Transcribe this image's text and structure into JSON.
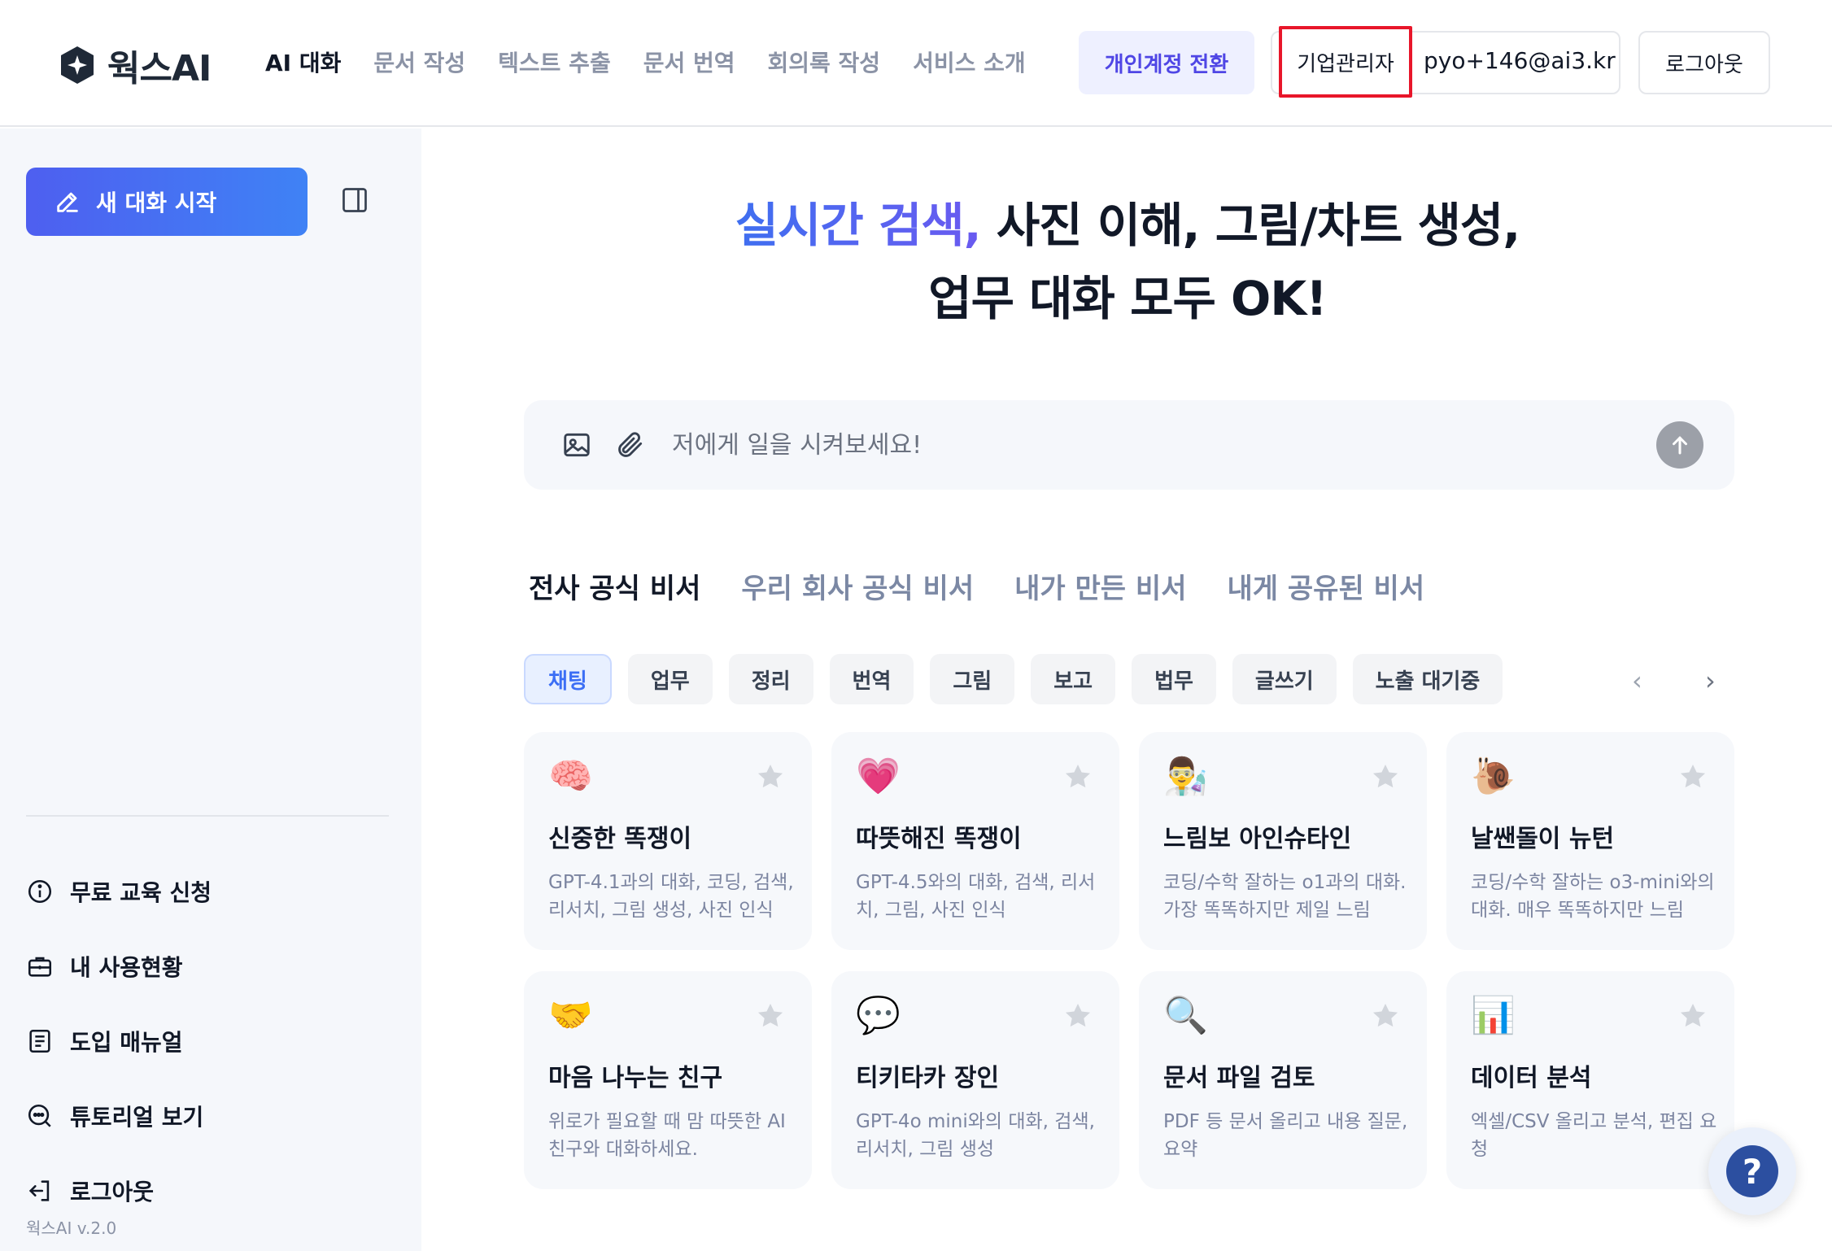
{
  "header": {
    "logo_text": "웍스AI",
    "nav": [
      "AI 대화",
      "문서 작성",
      "텍스트 추출",
      "문서 번역",
      "회의록 작성",
      "서비스 소개"
    ],
    "switch_label": "개인계정 전환",
    "admin_label": "기업관리자",
    "email": "pyo+146@ai3.kr",
    "logout_label": "로그아웃"
  },
  "sidebar": {
    "new_chat_label": "새 대화 시작",
    "menu": [
      {
        "label": "무료 교육 신청",
        "icon": "info-icon"
      },
      {
        "label": "내 사용현황",
        "icon": "briefcase-icon"
      },
      {
        "label": "도입 매뉴얼",
        "icon": "document-icon"
      },
      {
        "label": "튜토리얼 보기",
        "icon": "chat-search-icon"
      },
      {
        "label": "로그아웃",
        "icon": "logout-icon"
      }
    ],
    "version": "웍스AI v.2.0"
  },
  "hero": {
    "accent": "실시간 검색,",
    "line1_rest": " 사진 이해, 그림/차트 생성,",
    "line2": "업무 대화 모두 OK!"
  },
  "prompt": {
    "placeholder": "저에게 일을 시켜보세요!"
  },
  "tabs": [
    "전사 공식 비서",
    "우리 회사 공식 비서",
    "내가 만든 비서",
    "내게 공유된 비서"
  ],
  "chips": [
    "채팅",
    "업무",
    "정리",
    "번역",
    "그림",
    "보고",
    "법무",
    "글쓰기",
    "노출 대기중"
  ],
  "cards": [
    {
      "title": "신중한 똑쟁이",
      "desc": "GPT-4.1과의 대화, 코딩, 검색, 리서치, 그림 생성, 사진 인식",
      "icon": "brain-icon",
      "glyph": "🧠"
    },
    {
      "title": "따뜻해진 똑쟁이",
      "desc": "GPT-4.5와의 대화, 검색, 리서치, 그림, 사진 인식",
      "icon": "heart-head-icon",
      "glyph": "💗"
    },
    {
      "title": "느림보 아인슈타인",
      "desc": "코딩/수학 잘하는 o1과의 대화. 가장 똑똑하지만 제일 느림",
      "icon": "scientist-icon",
      "glyph": "👨‍🔬"
    },
    {
      "title": "날쌘돌이 뉴턴",
      "desc": "코딩/수학 잘하는 o3-mini와의 대화. 매우 똑똑하지만 느림",
      "icon": "snail-icon",
      "glyph": "🐌"
    },
    {
      "title": "마음 나누는 친구",
      "desc": "위로가 필요할 때 맘 따뜻한 AI 친구와 대화하세요.",
      "icon": "handshake-icon",
      "glyph": "🤝"
    },
    {
      "title": "티키타카 장인",
      "desc": "GPT-4o mini와의 대화, 검색, 리서치, 그림 생성",
      "icon": "speech-bubbles-icon",
      "glyph": "💬"
    },
    {
      "title": "문서 파일 검토",
      "desc": "PDF 등 문서 올리고 내용 질문, 요약",
      "icon": "document-search-icon",
      "glyph": "🔍"
    },
    {
      "title": "데이터 분석",
      "desc": "엑셀/CSV 올리고 분석, 편집 요청",
      "icon": "bar-chart-icon",
      "glyph": "📊"
    }
  ],
  "help": {
    "label": "?"
  }
}
